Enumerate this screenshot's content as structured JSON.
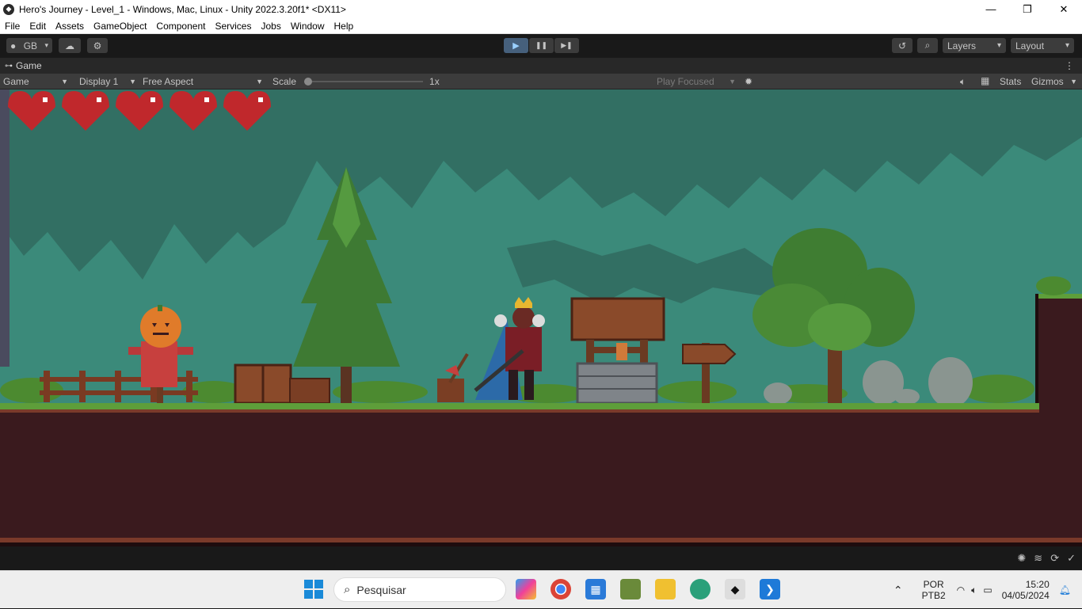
{
  "window": {
    "title": "Hero's Journey - Level_1 - Windows, Mac, Linux - Unity 2022.3.20f1* <DX11>",
    "controls": [
      "—",
      "❐",
      "✕"
    ]
  },
  "menu": {
    "items": [
      "File",
      "Edit",
      "Assets",
      "GameObject",
      "Component",
      "Services",
      "Jobs",
      "Window",
      "Help"
    ]
  },
  "toolbar": {
    "account_label": "GB",
    "play_icon": "▶",
    "pause_icon": "❚❚",
    "step_icon": "▶❚",
    "layers_label": "Layers",
    "layout_label": "Layout"
  },
  "tab": {
    "label": "Game",
    "menu_icon": "⋮"
  },
  "game_toolbar": {
    "mode_label": "Game",
    "display_label": "Display 1",
    "aspect_label": "Free Aspect",
    "scale_label": "Scale",
    "scale_value": "1x",
    "scale_fraction": 0.0,
    "play_mode_label": "Play Focused",
    "stats_label": "Stats",
    "gizmos_label": "Gizmos"
  },
  "game": {
    "hearts": 5,
    "colors": {
      "sky": "#3b8a7a",
      "canopy": "#326f63",
      "ground": "#3a1a1e",
      "grass": "#5e9e3a",
      "heart": "#c0282c"
    }
  },
  "taskbar": {
    "search_placeholder": "Pesquisar",
    "language_top": "POR",
    "language_bottom": "PTB2",
    "time": "15:20",
    "date": "04/05/2024"
  }
}
